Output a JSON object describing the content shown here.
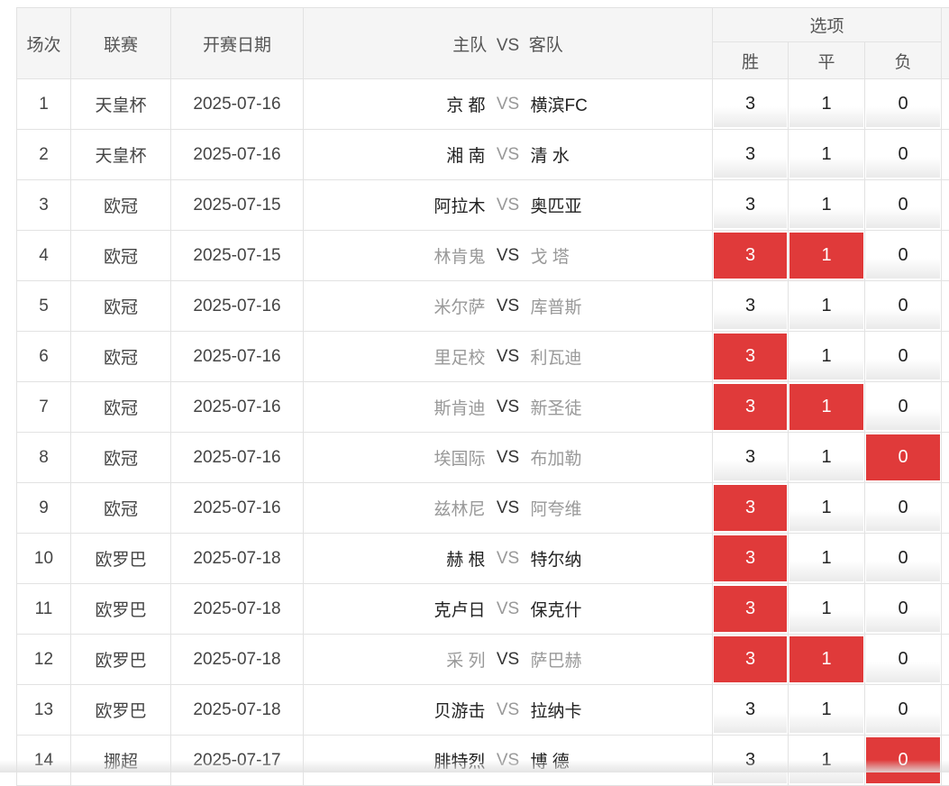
{
  "header": {
    "col_num": "场次",
    "col_league": "联赛",
    "col_date": "开赛日期",
    "col_home": "主队",
    "col_vs": "VS",
    "col_away": "客队",
    "col_options": "选项",
    "opt_win": "胜",
    "opt_draw": "平",
    "opt_lose": "负"
  },
  "vs_label": "VS",
  "colors": {
    "selected": "#e03a3a",
    "muted_text": "#999999"
  },
  "rows": [
    {
      "num": "1",
      "league": "天皇杯",
      "date": "2025-07-16",
      "home": "京 都",
      "away": "横滨FC",
      "muted": false,
      "win": "3",
      "draw": "1",
      "lose": "0",
      "sel": []
    },
    {
      "num": "2",
      "league": "天皇杯",
      "date": "2025-07-16",
      "home": "湘 南",
      "away": "清 水",
      "muted": false,
      "win": "3",
      "draw": "1",
      "lose": "0",
      "sel": []
    },
    {
      "num": "3",
      "league": "欧冠",
      "date": "2025-07-15",
      "home": "阿拉木",
      "away": "奥匹亚",
      "muted": false,
      "win": "3",
      "draw": "1",
      "lose": "0",
      "sel": []
    },
    {
      "num": "4",
      "league": "欧冠",
      "date": "2025-07-15",
      "home": "林肯鬼",
      "away": "戈 塔",
      "muted": true,
      "win": "3",
      "draw": "1",
      "lose": "0",
      "sel": [
        "win",
        "draw"
      ]
    },
    {
      "num": "5",
      "league": "欧冠",
      "date": "2025-07-16",
      "home": "米尔萨",
      "away": "库普斯",
      "muted": true,
      "win": "3",
      "draw": "1",
      "lose": "0",
      "sel": []
    },
    {
      "num": "6",
      "league": "欧冠",
      "date": "2025-07-16",
      "home": "里足校",
      "away": "利瓦迪",
      "muted": true,
      "win": "3",
      "draw": "1",
      "lose": "0",
      "sel": [
        "win"
      ]
    },
    {
      "num": "7",
      "league": "欧冠",
      "date": "2025-07-16",
      "home": "斯肯迪",
      "away": "新圣徒",
      "muted": true,
      "win": "3",
      "draw": "1",
      "lose": "0",
      "sel": [
        "win",
        "draw"
      ]
    },
    {
      "num": "8",
      "league": "欧冠",
      "date": "2025-07-16",
      "home": "埃国际",
      "away": "布加勒",
      "muted": true,
      "win": "3",
      "draw": "1",
      "lose": "0",
      "sel": [
        "lose"
      ]
    },
    {
      "num": "9",
      "league": "欧冠",
      "date": "2025-07-16",
      "home": "兹林尼",
      "away": "阿夸维",
      "muted": true,
      "win": "3",
      "draw": "1",
      "lose": "0",
      "sel": [
        "win"
      ]
    },
    {
      "num": "10",
      "league": "欧罗巴",
      "date": "2025-07-18",
      "home": "赫 根",
      "away": "特尔纳",
      "muted": false,
      "win": "3",
      "draw": "1",
      "lose": "0",
      "sel": [
        "win"
      ]
    },
    {
      "num": "11",
      "league": "欧罗巴",
      "date": "2025-07-18",
      "home": "克卢日",
      "away": "保克什",
      "muted": false,
      "win": "3",
      "draw": "1",
      "lose": "0",
      "sel": [
        "win"
      ]
    },
    {
      "num": "12",
      "league": "欧罗巴",
      "date": "2025-07-18",
      "home": "采 列",
      "away": "萨巴赫",
      "muted": true,
      "win": "3",
      "draw": "1",
      "lose": "0",
      "sel": [
        "win",
        "draw"
      ]
    },
    {
      "num": "13",
      "league": "欧罗巴",
      "date": "2025-07-18",
      "home": "贝游击",
      "away": "拉纳卡",
      "muted": false,
      "win": "3",
      "draw": "1",
      "lose": "0",
      "sel": []
    },
    {
      "num": "14",
      "league": "挪超",
      "date": "2025-07-17",
      "home": "腓特烈",
      "away": "博 德",
      "muted": false,
      "win": "3",
      "draw": "1",
      "lose": "0",
      "sel": [
        "lose"
      ]
    }
  ]
}
